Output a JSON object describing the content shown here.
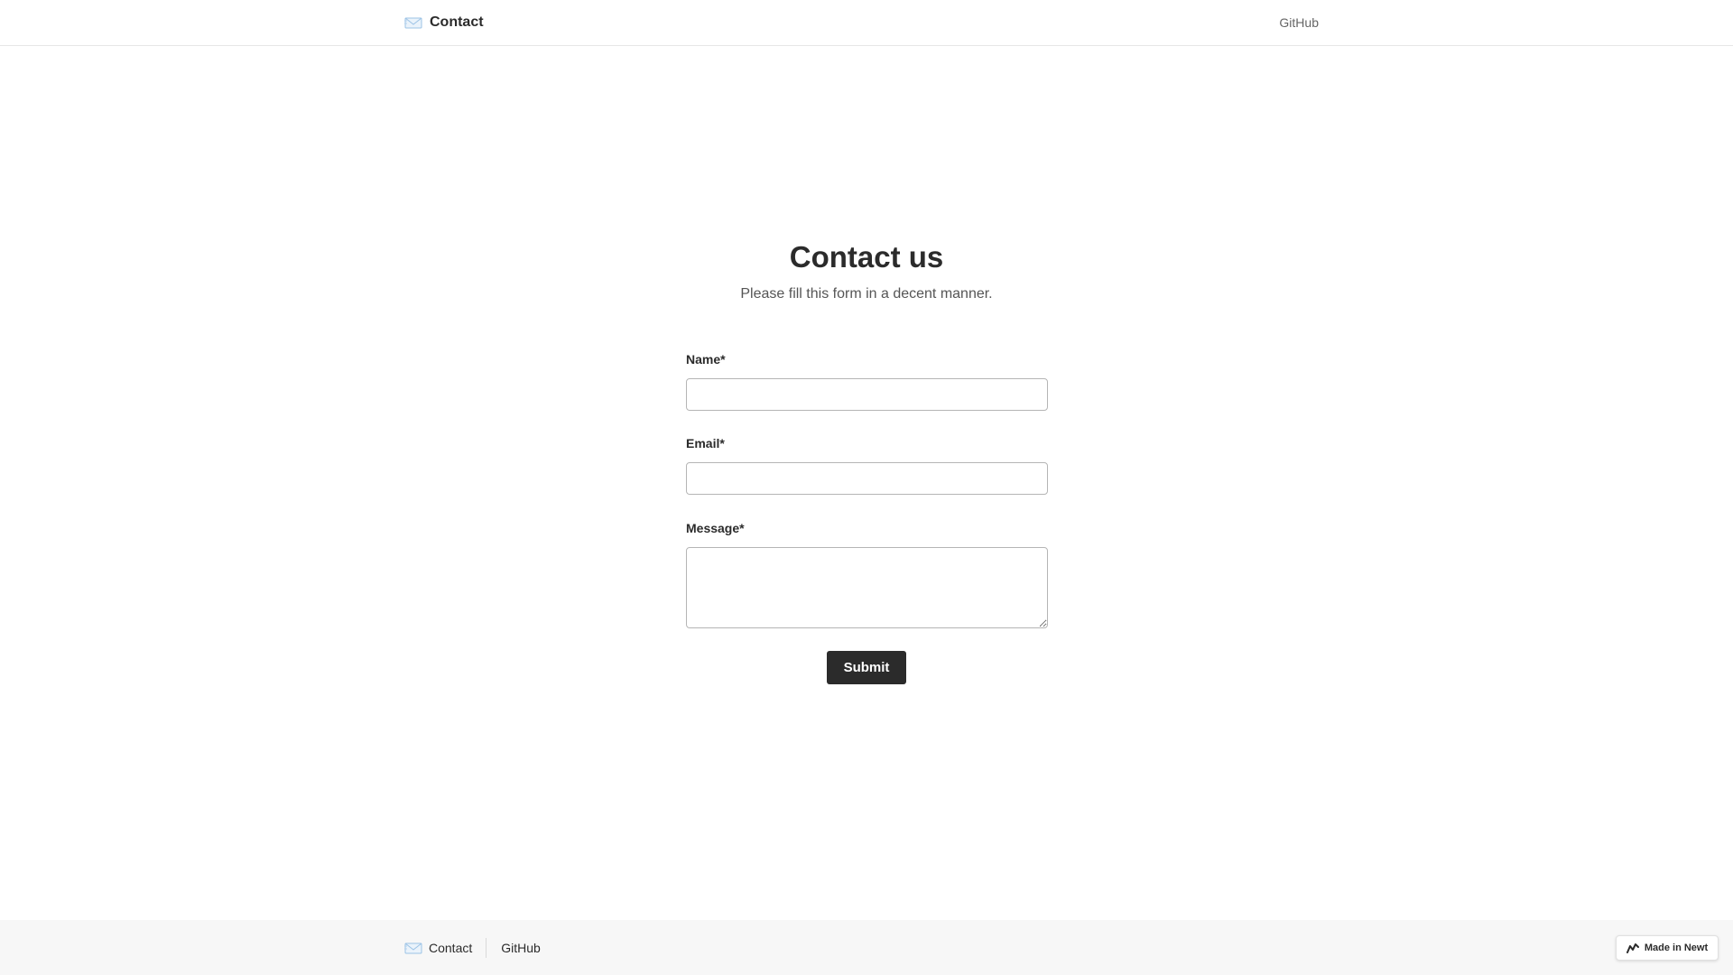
{
  "header": {
    "brand_icon": "envelope-icon",
    "brand_title": "Contact",
    "nav_link": "GitHub"
  },
  "main": {
    "title": "Contact us",
    "subtitle": "Please fill this form in a decent manner.",
    "form": {
      "name_label": "Name*",
      "name_value": "",
      "email_label": "Email*",
      "email_value": "",
      "message_label": "Message*",
      "message_value": "",
      "submit_label": "Submit"
    }
  },
  "footer": {
    "brand_icon": "envelope-icon",
    "brand_title": "Contact",
    "github_link": "GitHub",
    "badge_icon": "newt-logo-icon",
    "badge_label": "Made in Newt"
  },
  "colors": {
    "text": "#2b2b2b",
    "button_bg": "#2b2b2b",
    "footer_bg": "#f7f7f7",
    "input_border": "#b5b5b5"
  }
}
